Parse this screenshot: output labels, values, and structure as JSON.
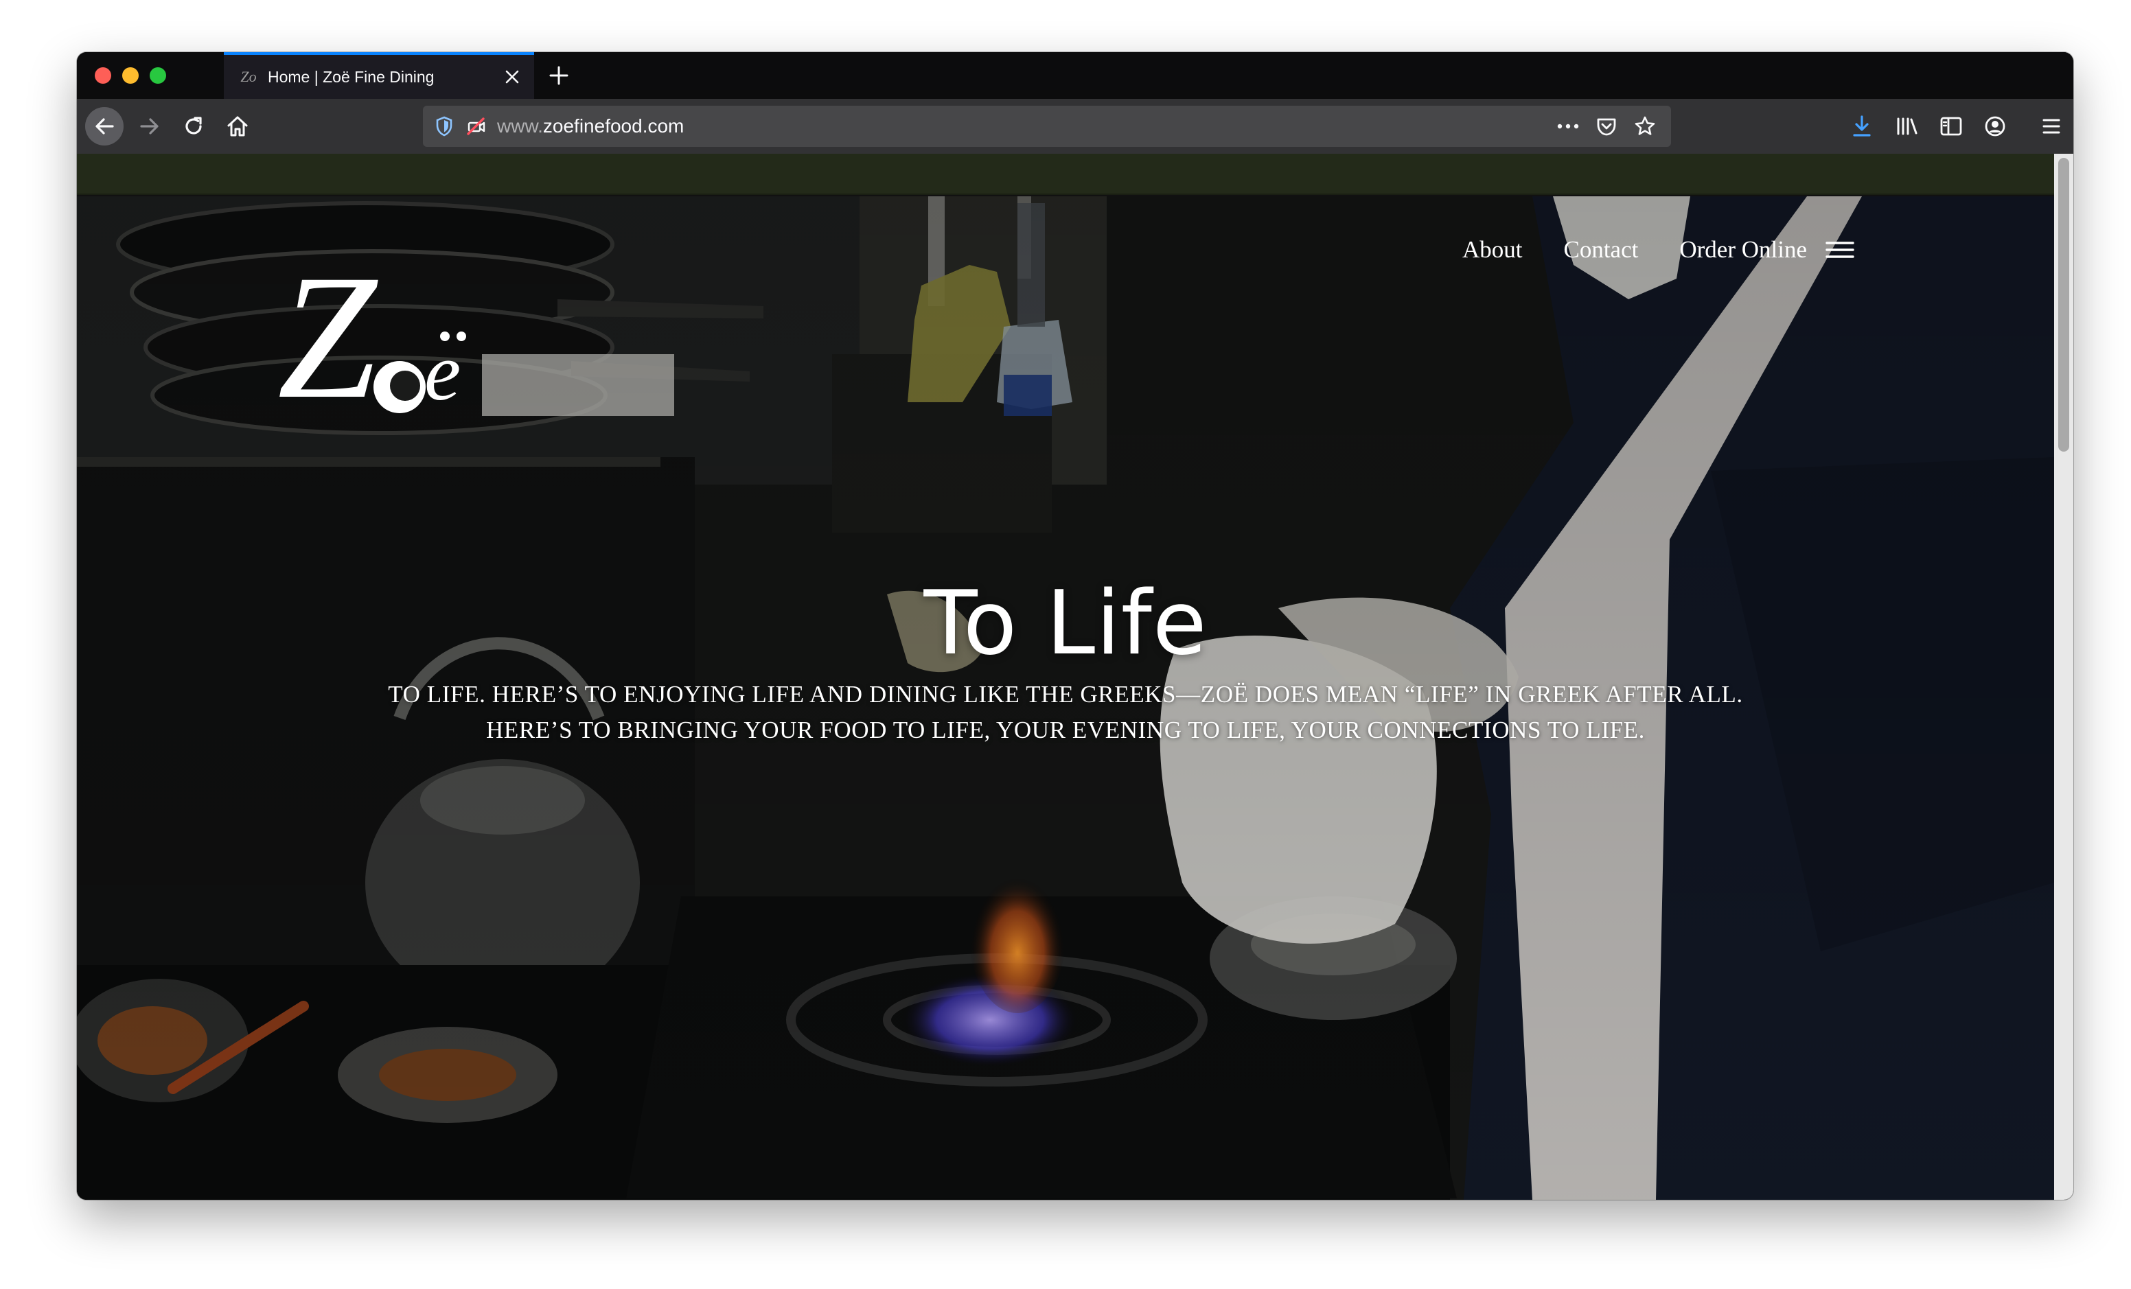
{
  "browser": {
    "tab": {
      "title": "Home | Zoë Fine Dining",
      "favicon": "zoe-logo-favicon"
    },
    "url": {
      "prefix": "www.",
      "domain": "zoefinefood.com"
    },
    "accent_color": "#0a84ff",
    "icons": {
      "back": "arrow-left-icon",
      "forward": "arrow-right-icon",
      "reload": "reload-icon",
      "home": "home-icon",
      "tracking": "shield-icon",
      "permissions": "blocked-camera-icon",
      "page_actions": "ellipsis-icon",
      "pocket": "pocket-icon",
      "bookmark": "star-icon",
      "downloads": "download-arrow-icon",
      "library": "library-icon",
      "sidebar": "sidebar-icon",
      "account": "account-icon",
      "menu": "hamburger-menu-icon",
      "new_tab": "plus-icon",
      "close_tab": "close-icon"
    }
  },
  "site": {
    "logo_text": "Zoë",
    "nav": [
      {
        "label": "About"
      },
      {
        "label": "Contact"
      },
      {
        "label": "Order Online"
      }
    ],
    "menu_icon": "hamburger-menu-icon",
    "hero": {
      "title": "To Life",
      "subtitle_line1": "TO LIFE. HERE’S TO ENJOYING LIFE AND DINING LIKE THE GREEKS—ZOË DOES MEAN “LIFE” IN GREEK AFTER ALL.",
      "subtitle_line2": "HERE’S TO BRINGING YOUR FOOD TO LIFE, YOUR EVENING TO LIFE, YOUR CONNECTIONS TO LIFE."
    },
    "strip_color": "#232a19"
  }
}
